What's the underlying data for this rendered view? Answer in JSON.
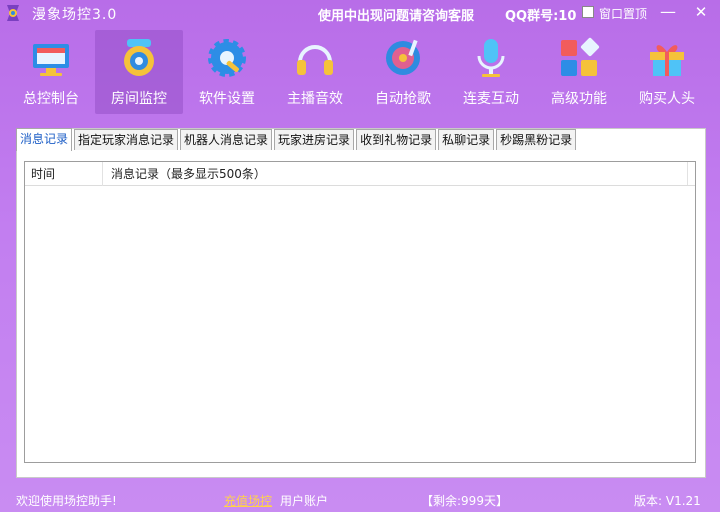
{
  "titlebar": {
    "app_title": "漫象场控3.0",
    "notice": "使用中出现问题请咨询客服",
    "qq_label": "QQ群号:10",
    "pin_label": "窗口置顶",
    "minimize": "—",
    "close": "✕"
  },
  "toolbar": {
    "items": [
      {
        "label": "总控制台",
        "icon": "console-icon"
      },
      {
        "label": "房间监控",
        "icon": "camera-icon"
      },
      {
        "label": "软件设置",
        "icon": "gear-icon"
      },
      {
        "label": "主播音效",
        "icon": "headphones-icon"
      },
      {
        "label": "自动抢歌",
        "icon": "disc-icon"
      },
      {
        "label": "连麦互动",
        "icon": "microphone-icon"
      },
      {
        "label": "高级功能",
        "icon": "apps-icon"
      },
      {
        "label": "购买人头",
        "icon": "gift-icon"
      }
    ],
    "active_index": 1
  },
  "tabs": [
    "消息记录",
    "指定玩家消息记录",
    "机器人消息记录",
    "玩家进房记录",
    "收到礼物记录",
    "私聊记录",
    "秒踢黑粉记录"
  ],
  "list": {
    "columns": [
      "时间",
      "消息记录（最多显示500条）"
    ],
    "rows": []
  },
  "status": {
    "welcome": "欢迎使用场控助手!",
    "recharge": "充值场控",
    "account": "用户账户",
    "remaining": "【剩余:999天】",
    "version": "版本: V1.21"
  },
  "colors": {
    "background": "#c27ef0",
    "active_tab_text": "#1e5fc7",
    "recharge_link": "#ffd24a"
  }
}
